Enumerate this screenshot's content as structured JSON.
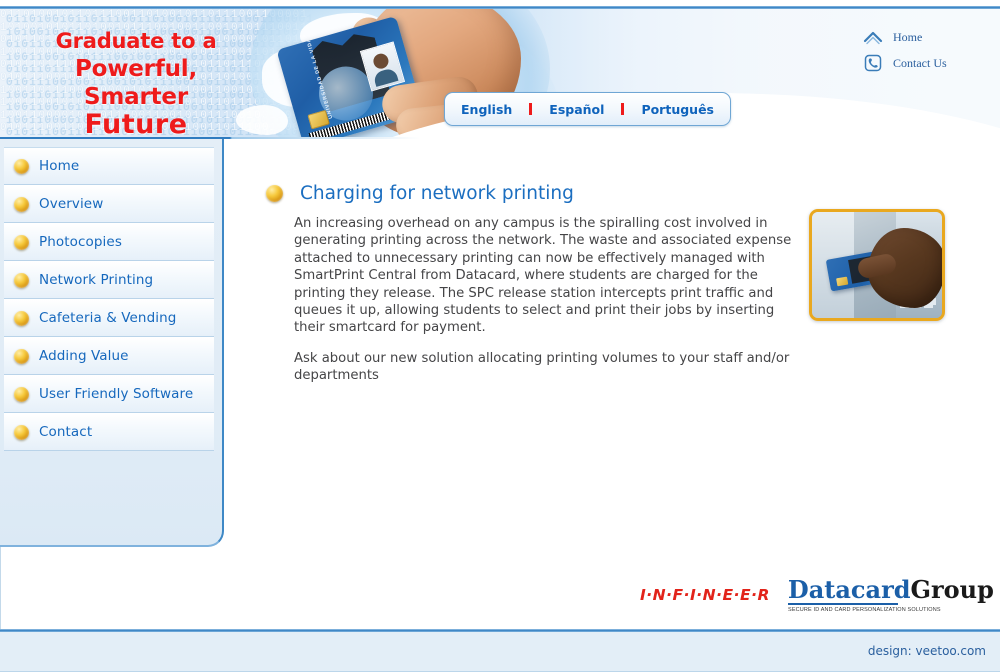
{
  "banner": {
    "headline_line1": "Graduate to a",
    "headline_line2": "Powerful, Smarter",
    "headline_line3": "Future",
    "card_label": "UNIVERSIDAD DE LA VIDA",
    "binary_text": "0110100101101110011010010110111001100001\n1010010101101001011100100110010101110011\n0101101001011011100110111001100001011011\n1001100101011100100110010101110011011010\n0101101110011011100110000101101110011001\n0101110010011001010111001101101001011011\n1001101110011000010110111001100101011100\n1001100101011100110110100101101110011011\n1001100001011011100110010101110010011001\n0101110011011010010110111001101110011000\n"
  },
  "util_nav": {
    "items": [
      {
        "icon": "home-icon",
        "label": "Home"
      },
      {
        "icon": "phone-icon",
        "label": "Contact Us"
      }
    ]
  },
  "languages": {
    "items": [
      {
        "label": "English"
      },
      {
        "label": "Español"
      },
      {
        "label": "Português"
      }
    ]
  },
  "sidebar": {
    "items": [
      {
        "label": "Home"
      },
      {
        "label": "Overview"
      },
      {
        "label": "Photocopies"
      },
      {
        "label": "Network Printing"
      },
      {
        "label": "Cafeteria & Vending"
      },
      {
        "label": "Adding Value"
      },
      {
        "label": "User Friendly Software"
      },
      {
        "label": "Contact"
      }
    ]
  },
  "main": {
    "title": "Charging for network printing",
    "paragraph1": "An increasing overhead on any campus is the spiralling cost involved in generating printing across the network. The waste and associated expense attached to unnecessary printing can now be effectively managed with SmartPrint Central from Datacard, where students are charged for the printing they release. The SPC release station intercepts print traffic and queues it up, allowing students to select and print their jobs by inserting their smartcard for payment.",
    "paragraph2": "Ask about our new solution allocating printing volumes to your staff and/or departments"
  },
  "footer": {
    "infineer_logo": "I·N·F·I·N·E·E·R",
    "datacard_brand_blue": "Datacard",
    "datacard_brand_black": "Group",
    "datacard_tagline": "SECURE ID AND CARD PERSONALIZATION SOLUTIONS",
    "design_credit": "design: veetoo.com"
  },
  "colors": {
    "headline_red": "#ee1b1b",
    "link_blue": "#1668bd",
    "heading_blue": "#1b6ec0",
    "bullet_gold": "#f6c93c",
    "photo_border_gold": "#e9a81f",
    "rule_blue": "#2f7cc0",
    "panel_blue": "#e4eef7"
  }
}
